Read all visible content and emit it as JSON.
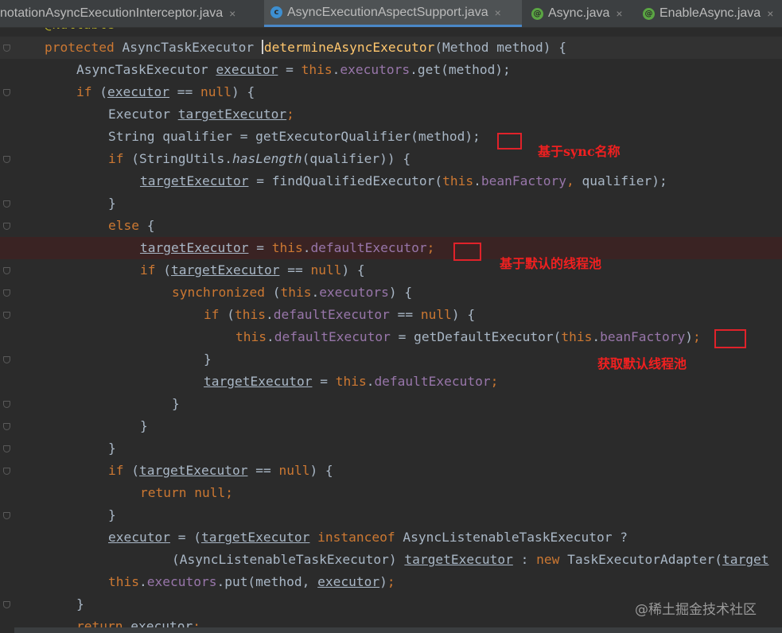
{
  "tabs": [
    {
      "label": "notationAsyncExecutionInterceptor.java",
      "icon": "class-icon",
      "active": false
    },
    {
      "label": "AsyncExecutionAspectSupport.java",
      "icon": "class-icon",
      "active": true
    },
    {
      "label": "Async.java",
      "icon": "annotation-icon",
      "active": false
    },
    {
      "label": "EnableAsync.java",
      "icon": "annotation-icon",
      "active": false
    }
  ],
  "tab_close_glyph": "×",
  "code": {
    "annotation": "@Nullable",
    "protected": "protected",
    "ret_type": "AsyncTaskExecutor",
    "method_name": "determineAsyncExecutor",
    "params": "(Method method) {",
    "executor_var": "executor",
    "this": "this",
    "executors_field": "executors",
    "get_call": ".get(method);",
    "if_kw": "if",
    "eq_null": "== ",
    "null_kw": "null",
    "executor_type": "Executor",
    "target_var": "targetExecutor",
    "string_type": "String",
    "qualifier_assign": "qualifier = getExecutorQualifier(method);",
    "stringutils": "StringUtils.",
    "has_length": "hasLength",
    "qualifier_arg": "(qualifier)) {",
    "find_qualified": "findQualifiedExecutor(",
    "bean_factory": "beanFactory",
    "qualifier_end": "qualifier);",
    "close_brace": "}",
    "else_kw": "else",
    "default_executor": "defaultExecutor",
    "synchronized_kw": "synchronized",
    "get_default": "getDefaultExecutor(",
    "return_kw": "return",
    "instanceof_kw": "instanceof",
    "listenable_type": "AsyncListenableTaskExecutor",
    "new_kw": "new",
    "adapter_call": "TaskExecutorAdapter(",
    "adapter_trail": "target",
    "put_call": ".put(method, "
  },
  "notes": {
    "n1": "基于sync名称",
    "n2": "基于默认的线程池",
    "n3": "获取默认线程池"
  },
  "watermark": "@稀土掘金技术社区",
  "colors": {
    "keyword": "#cc7832",
    "method": "#ffc66d",
    "field": "#9876aa",
    "text": "#a9b7c6",
    "annotation": "#bbb529",
    "highlight_box": "#e0222a"
  }
}
